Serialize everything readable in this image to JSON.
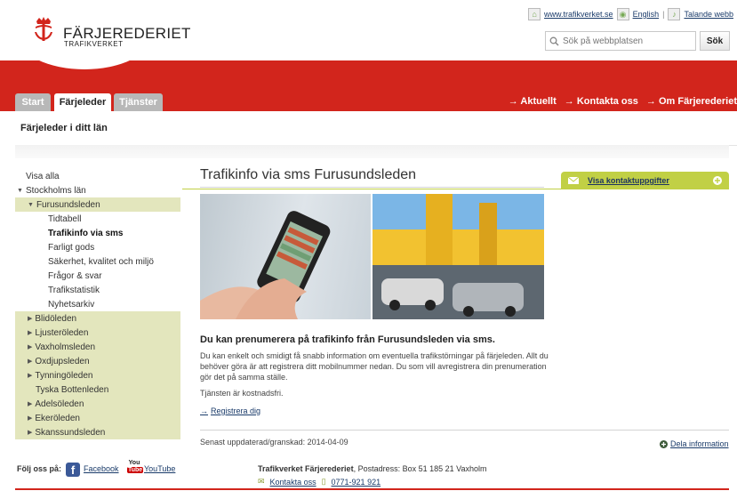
{
  "brand": {
    "name": "FÄRJEREDERIET",
    "sub": "TRAFIKVERKET",
    "color": "#d2251c"
  },
  "toplinks": {
    "trafikverket": "www.trafikverket.se",
    "english": "English",
    "talande": "Talande webb"
  },
  "search": {
    "placeholder": "Sök på webbplatsen",
    "button": "Sök"
  },
  "tabs": [
    {
      "label": "Start"
    },
    {
      "label": "Färjeleder"
    },
    {
      "label": "Tjänster"
    }
  ],
  "topnav": [
    "Aktuellt",
    "Kontakta oss",
    "Om Färjerederiet"
  ],
  "subtitle": "Färjeleder i ditt län",
  "sidebar": {
    "items": [
      {
        "label": "Visa alla"
      },
      {
        "label": "Stockholms län"
      },
      {
        "label": "Furusundsleden"
      },
      {
        "label": "Tidtabell"
      },
      {
        "label": "Trafikinfo via sms"
      },
      {
        "label": "Farligt gods"
      },
      {
        "label": "Säkerhet, kvalitet och miljö"
      },
      {
        "label": "Frågor & svar"
      },
      {
        "label": "Trafikstatistik"
      },
      {
        "label": "Nyhetsarkiv"
      },
      {
        "label": "Blidöleden"
      },
      {
        "label": "Ljusteröleden"
      },
      {
        "label": "Vaxholmsleden"
      },
      {
        "label": "Oxdjupsleden"
      },
      {
        "label": "Tynningöleden"
      },
      {
        "label": "Tyska Bottenleden"
      },
      {
        "label": "Adelsöleden"
      },
      {
        "label": "Ekeröleden"
      },
      {
        "label": "Skanssundsleden"
      }
    ]
  },
  "main": {
    "title": "Trafikinfo via sms Furusundsleden",
    "heading": "Du kan prenumerera på trafikinfo från Furusundsleden via sms.",
    "para1": "Du kan enkelt och smidigt få snabb information om eventuella trafikstörningar på färjeleden. Allt du behöver göra är att registrera ditt mobilnummer nedan. Du som vill avregistrera din prenumeration gör det på samma ställe.",
    "para2": "Tjänsten är kostnadsfri.",
    "register": "Registrera dig",
    "updated": "Senast uppdaterad/granskad: 2014-04-09",
    "share": "Dela information"
  },
  "contact": {
    "label": "Visa kontaktuppgifter"
  },
  "footer": {
    "follow": "Följ oss på:",
    "facebook": "Facebook",
    "youtube": "YouTube",
    "org": "Trafikverket Färjerederiet",
    "address": ", Postadress: Box 51 185 21 Vaxholm",
    "contact": "Kontakta oss",
    "phone": "0771-921 921"
  }
}
